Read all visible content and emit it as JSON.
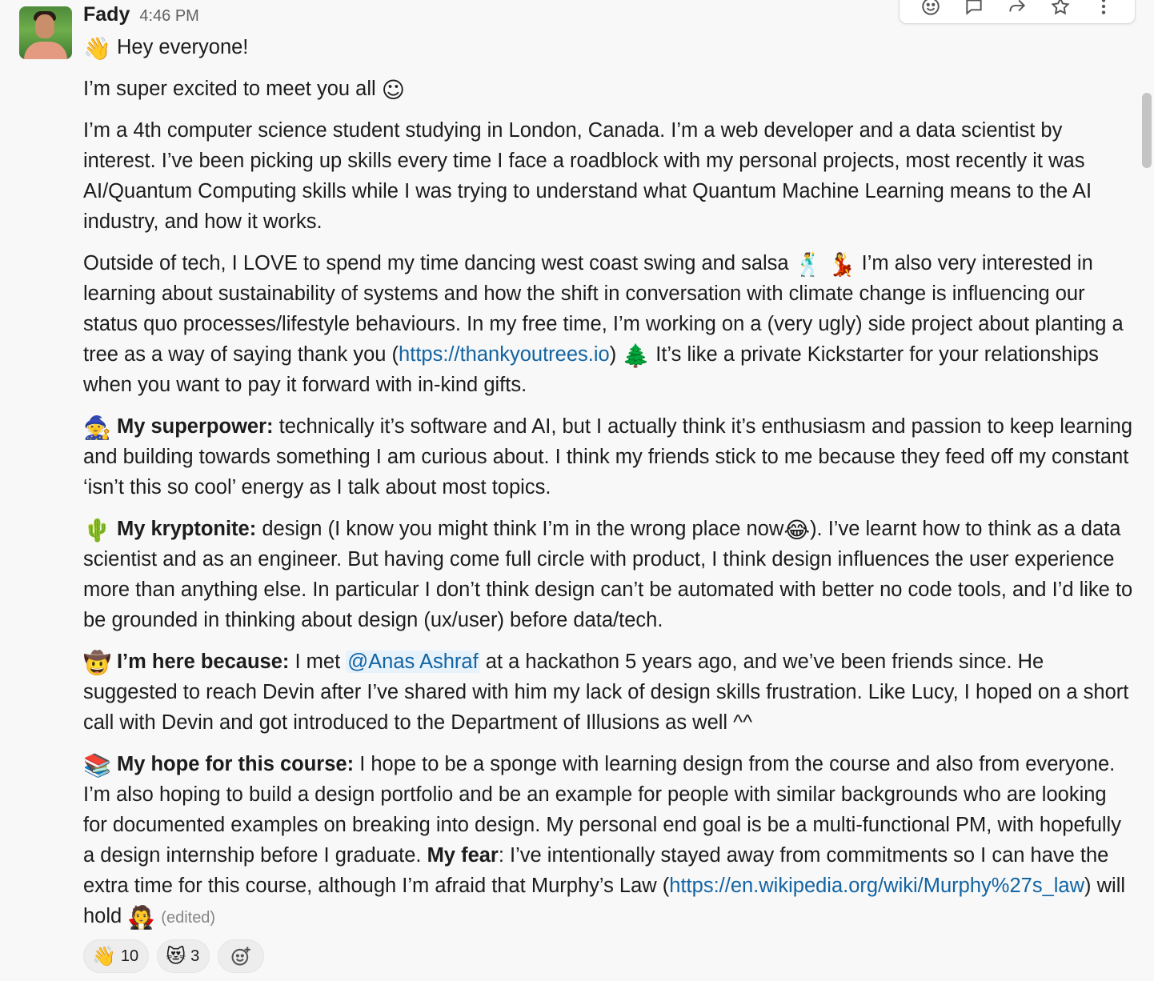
{
  "message": {
    "author": "Fady",
    "time": "4:46 PM",
    "greeting_emoji": "👋",
    "greeting": "Hey everyone!",
    "p2_text": "I’m super excited to meet you all",
    "p2_emoji": "☺",
    "p3": "I’m a 4th computer science student studying in London, Canada. I’m a web developer and a data scientist by interest. I’ve been picking up skills every time I face a roadblock with my personal projects, most recently it was AI/Quantum Computing skills while I was trying to understand what Quantum Machine Learning means to the AI industry, and how it works.",
    "p4_a": "Outside of tech, I LOVE to spend my time dancing west coast swing and salsa",
    "p4_emoji1": "🕺",
    "p4_emoji2": "💃",
    "p4_b": "I’m also very interested in learning about sustainability of systems and how the shift in conversation with climate change is influencing our status quo processes/lifestyle behaviours. In my free time, I’m working on a (very ugly) side project about planting a tree as a way of saying thank you (",
    "p4_link": "https://thankyoutrees.io",
    "p4_c": ")",
    "p4_emoji3": "🌲",
    "p4_d": "It’s like a private Kickstarter for your relationships when you want to pay it forward with in-kind gifts.",
    "p5_emoji": "🧙",
    "p5_label": "My superpower:",
    "p5_text": "technically it’s software and AI, but I actually think it’s enthusiasm and passion to keep learning and building towards something I am curious about. I think my friends stick to me because they feed off my constant ‘isn’t this so cool’ energy as I talk about most topics.",
    "p6_emoji": "🌵",
    "p6_label": "My kryptonite:",
    "p6_a": "design (I know you might think I’m in the wrong place now",
    "p6_emoji2": "😂",
    "p6_b": "). I’ve learnt how to think as a data scientist and as an engineer. But having come full circle with product, I think design influences the user experience more than anything else. In particular I don’t think design can’t be automated with better no code tools, and I’d like to be grounded in thinking about design (ux/user) before data/tech.",
    "p7_emoji": "🤠",
    "p7_label": "I’m here because:",
    "p7_a": "I met",
    "p7_mention": "@Anas Ashraf",
    "p7_b": "at a hackathon 5 years ago, and we’ve been friends since. He suggested to reach Devin after I’ve shared with him my lack of design skills frustration. Like Lucy, I hoped on a short call with Devin and got introduced to the Department of Illusions as well ^^",
    "p8_emoji": "📚",
    "p8_label": "My hope for this course:",
    "p8_a": "I hope to be a sponge with learning design from the course and also from everyone. I’m also hoping to build a design portfolio and be an example for people with similar backgrounds who are looking for documented examples on breaking into design. My personal end goal is be a multi-functional PM, with hopefully a design internship before I graduate.",
    "p8_label2": "My fear",
    "p8_b": ": I’ve intentionally stayed away from commitments so I can have the extra time for this course, although I’m afraid that Murphy’s Law (",
    "p8_link": "https://en.wikipedia.org/wiki/Murphy%27s_law",
    "p8_c": ") will hold",
    "p8_emoji2": "🧛",
    "edited": "(edited)"
  },
  "reactions": [
    {
      "emoji": "👋",
      "count": "10"
    },
    {
      "emoji": "😻",
      "count": "3"
    }
  ],
  "icons": [
    "emoji-reaction-icon",
    "reply-thread-icon",
    "share-forward-icon",
    "star-icon",
    "more-actions-icon",
    "add-reaction-icon"
  ]
}
